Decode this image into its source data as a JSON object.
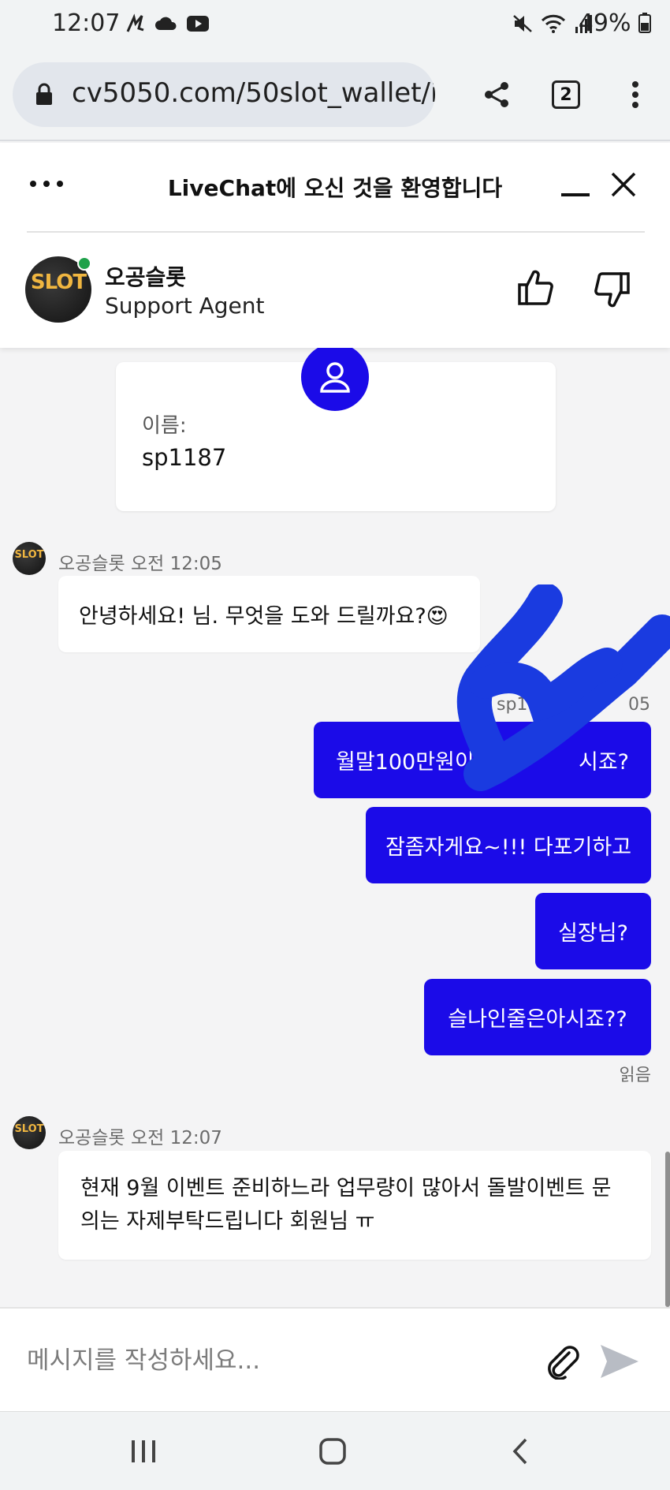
{
  "status_bar": {
    "time": "12:07",
    "battery": "49%",
    "left_icons": [
      "signature-icon",
      "cloud-icon",
      "youtube-icon"
    ],
    "right_icons": [
      "mute-icon",
      "wifi-icon",
      "signal-icon",
      "battery-icon"
    ]
  },
  "browser": {
    "url": "cv5050.com/50slot_wallet/i",
    "tab_count": "2"
  },
  "chat_header": {
    "title": "LiveChat에 오신 것을 환영합니다",
    "agent_name": "오공슬롯",
    "agent_role": "Support Agent",
    "agent_logo_text": "SLOT",
    "online_color": "#1fa14a"
  },
  "form_card": {
    "label": "이름:",
    "value": "sp1187"
  },
  "messages": {
    "agent_meta_1": "오공슬롯 오전 12:05",
    "agent_msg_1": "안녕하세요! 님. 무엇을 도와 드릴까요?😍",
    "user_meta_visible": "sp1",
    "user_meta_time_visible": "05",
    "user_msg_1": "월말100만원이상",
    "user_msg_1_tail": "시죠?",
    "user_msg_2": "잠좀자게요~!!! 다포기하고",
    "user_msg_3": "실장님?",
    "user_msg_4": "슬나인줄은아시죠??",
    "read_status": "읽음",
    "agent_meta_2": "오공슬롯 오전 12:07",
    "agent_msg_2": "현재 9월 이벤트 준비하느라 업무량이 많아서 돌발이벤트 문의는 자제부탁드립니다 회원님 ㅠ"
  },
  "composer": {
    "placeholder": "메시지를 작성하세요..."
  },
  "colors": {
    "accent": "#1b0be8",
    "scribble": "#1a3be0"
  }
}
